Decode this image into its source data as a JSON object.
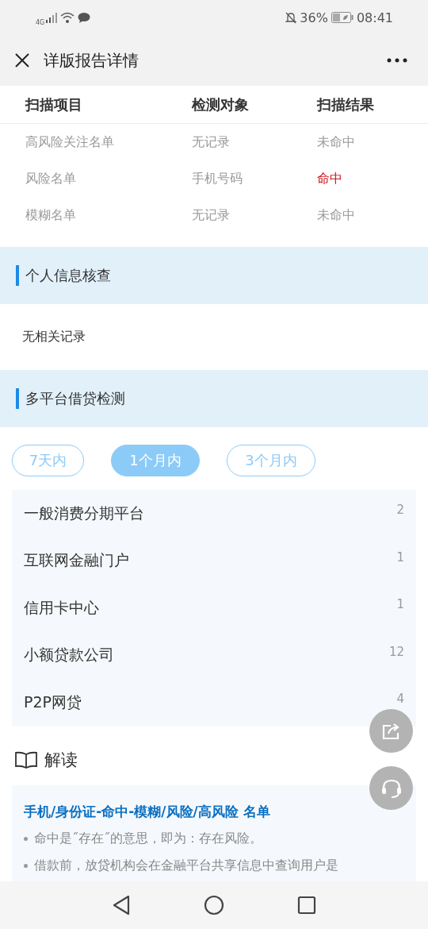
{
  "status_bar": {
    "network": "4G",
    "battery": "36%",
    "time": "08:41"
  },
  "header": {
    "title": "详版报告详情"
  },
  "scan_table": {
    "columns": [
      "扫描项目",
      "检测对象",
      "扫描结果"
    ],
    "rows": [
      {
        "item": "高风险关注名单",
        "target": "无记录",
        "result": "未命中",
        "hit": false
      },
      {
        "item": "风险名单",
        "target": "手机号码",
        "result": "命中",
        "hit": true
      },
      {
        "item": "模糊名单",
        "target": "无记录",
        "result": "未命中",
        "hit": false
      }
    ]
  },
  "personal_check": {
    "title": "个人信息核查",
    "text": "无相关记录"
  },
  "multi_platform": {
    "title": "多平台借贷检测",
    "tabs": [
      {
        "label": "7天内",
        "selected": false
      },
      {
        "label": "1个月内",
        "selected": true
      },
      {
        "label": "3个月内",
        "selected": false
      }
    ],
    "items": [
      {
        "name": "一般消费分期平台",
        "count": "2"
      },
      {
        "name": "互联网金融门户",
        "count": "1"
      },
      {
        "name": "信用卡中心",
        "count": "1"
      },
      {
        "name": "小额贷款公司",
        "count": "12"
      },
      {
        "name": "P2P网贷",
        "count": "4"
      }
    ]
  },
  "interpretation": {
    "title": "解读",
    "heading": "手机/身份证-命中-模糊/风险/高风险 名单",
    "bullets": [
      "命中是˝存在˝的意思，即为：存在风险。",
      "借款前，放贷机构会在金融平台共享信息中查询用户是"
    ]
  }
}
